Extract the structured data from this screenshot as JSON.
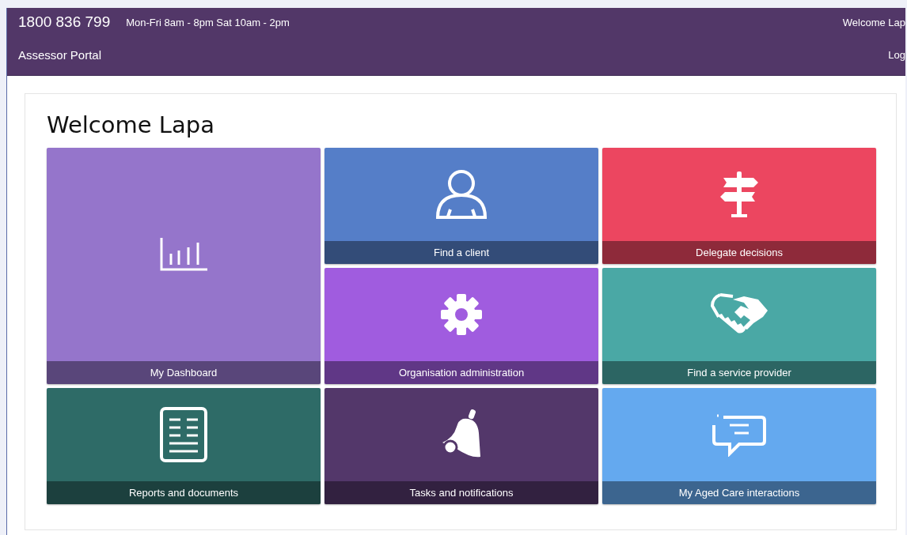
{
  "header": {
    "phone": "1800 836 799",
    "hours": "Mon-Fri 8am - 8pm Sat 10am - 2pm",
    "welcome": "Welcome Lap",
    "portal": "Assessor Portal",
    "logout": "Log"
  },
  "heading": "Welcome Lapa",
  "tiles": [
    {
      "label": "Find a client",
      "color": "#557ec8",
      "kind": "regular"
    },
    {
      "label": "Delegate decisions",
      "color": "#ec4660",
      "kind": "regular"
    },
    {
      "label": "My Dashboard",
      "color": "#9575cb",
      "kind": "tall"
    },
    {
      "label": "Organisation administration",
      "color": "#a05cdf",
      "kind": "regular"
    },
    {
      "label": "Find a service provider",
      "color": "#4aa8a5",
      "kind": "regular"
    },
    {
      "label": "Reports and documents",
      "color": "#2e6b67",
      "kind": "regular"
    },
    {
      "label": "Tasks and notifications",
      "color": "#53376a",
      "kind": "regular"
    },
    {
      "label": "My Aged Care interactions",
      "color": "#64a9ef",
      "kind": "regular"
    }
  ]
}
